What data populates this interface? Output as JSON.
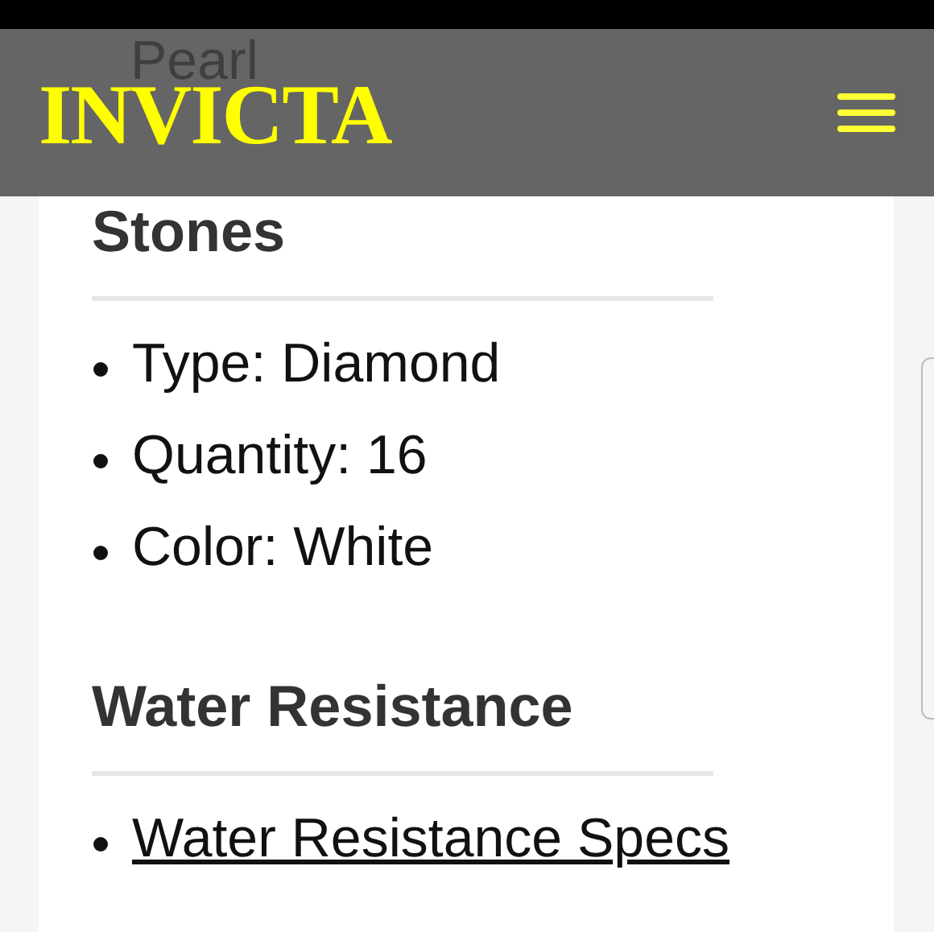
{
  "header": {
    "logo": "INVICTA"
  },
  "behind_header_text": "Pearl",
  "sections": [
    {
      "heading": "Stones",
      "items": [
        {
          "kind": "text",
          "text": "Type: Diamond"
        },
        {
          "kind": "text",
          "text": "Quantity: 16"
        },
        {
          "kind": "text",
          "text": "Color: White"
        }
      ]
    },
    {
      "heading": "Water Resistance",
      "items": [
        {
          "kind": "link",
          "text": "Water Resistance Specs"
        }
      ]
    }
  ]
}
